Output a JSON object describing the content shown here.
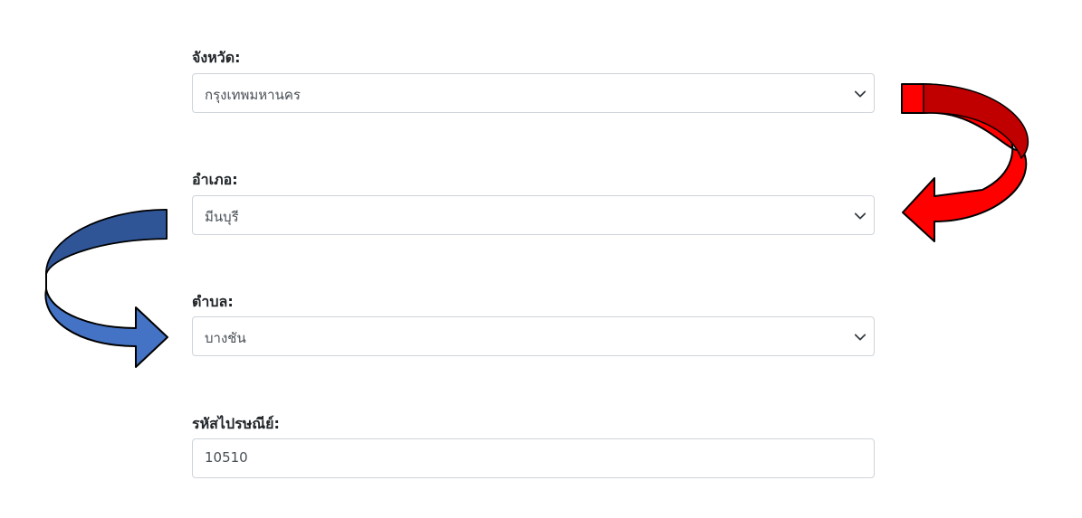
{
  "form": {
    "province": {
      "label": "จังหวัด:",
      "value": "กรุงเทพมหานคร",
      "control": "select"
    },
    "district": {
      "label": "อำเภอ:",
      "value": "มีนบุรี",
      "control": "select"
    },
    "subdistrict": {
      "label": "ตำบล:",
      "value": "บางชัน",
      "control": "select"
    },
    "postal_code": {
      "label": "รหัสไปรษณีย์:",
      "value": "10510",
      "control": "input"
    }
  },
  "annotations": {
    "arrow_province_to_district": {
      "color": "#e00000",
      "color_dark": "#c00000",
      "icon": "curved-arrow-icon"
    },
    "arrow_district_to_subdistrict": {
      "color": "#4472c4",
      "color_dark": "#2f5597",
      "icon": "curved-arrow-icon"
    }
  },
  "icons": {
    "select_caret": "chevron-down-icon"
  }
}
